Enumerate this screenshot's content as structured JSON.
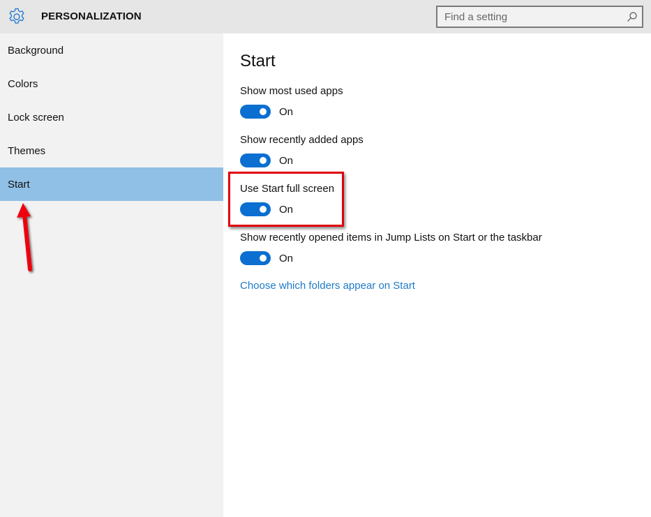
{
  "header": {
    "icon": "gear-icon",
    "title": "PERSONALIZATION",
    "search": {
      "placeholder": "Find a setting",
      "value": "",
      "icon": "search-icon"
    }
  },
  "sidebar": {
    "items": [
      {
        "label": "Background",
        "selected": false
      },
      {
        "label": "Colors",
        "selected": false
      },
      {
        "label": "Lock screen",
        "selected": false
      },
      {
        "label": "Themes",
        "selected": false
      },
      {
        "label": "Start",
        "selected": true
      }
    ]
  },
  "main": {
    "title": "Start",
    "settings": [
      {
        "label": "Show most used apps",
        "state": "On",
        "on": true
      },
      {
        "label": "Show recently added apps",
        "state": "On",
        "on": true
      },
      {
        "label": "Use Start full screen",
        "state": "On",
        "on": true,
        "highlighted": true
      },
      {
        "label": "Show recently opened items in Jump Lists on Start or the taskbar",
        "state": "On",
        "on": true
      }
    ],
    "link": "Choose which folders appear on Start"
  },
  "annotations": {
    "arrow": "red arrow pointing to Start",
    "highlight_box": "red box around Use Start full screen",
    "color": "#e0000f"
  },
  "colors": {
    "accent": "#0a6fd1",
    "selected_nav": "#91c0e6",
    "link": "#1e7ac8"
  }
}
